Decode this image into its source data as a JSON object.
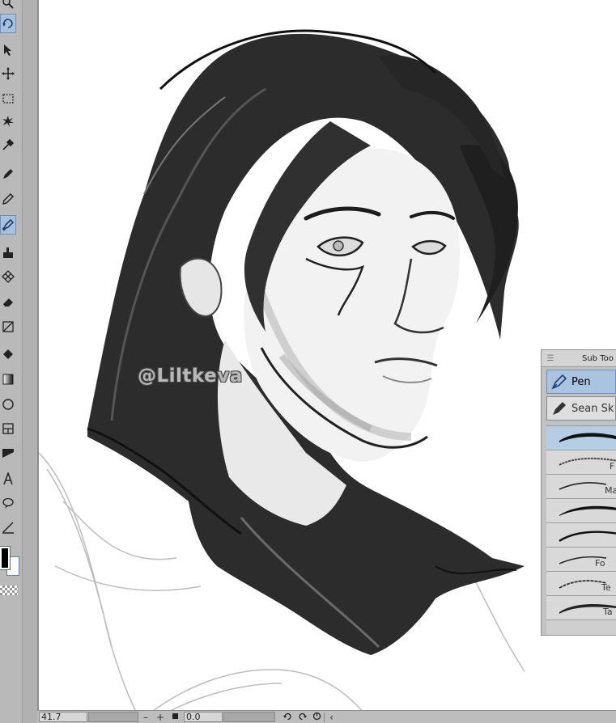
{
  "toolbar": {
    "tools": [
      {
        "name": "zoom-tool-icon",
        "active": false
      },
      {
        "name": "rotate-view-tool-icon",
        "active": true
      },
      {
        "name": "object-select-tool-icon",
        "active": false
      },
      {
        "name": "move-layer-tool-icon",
        "active": false
      },
      {
        "name": "rectangle-selection-tool-icon",
        "active": false
      },
      {
        "name": "auto-select-tool-icon",
        "active": false
      },
      {
        "name": "eyedropper-tool-icon",
        "active": false
      },
      {
        "name": "pen-tool-icon",
        "active": false
      },
      {
        "name": "pencil-tool-icon",
        "active": false
      },
      {
        "name": "brush-tool-icon",
        "active": true
      },
      {
        "name": "airbrush-tool-icon",
        "active": false
      },
      {
        "name": "decoration-tool-icon",
        "active": false
      },
      {
        "name": "eraser-tool-icon",
        "active": false
      },
      {
        "name": "blend-tool-icon",
        "active": false
      },
      {
        "name": "fill-tool-icon",
        "active": false
      },
      {
        "name": "gradient-tool-icon",
        "active": false
      },
      {
        "name": "figure-tool-icon",
        "active": false
      },
      {
        "name": "frame-border-tool-icon",
        "active": false
      },
      {
        "name": "ruler-tool-icon",
        "active": false
      },
      {
        "name": "text-tool-icon",
        "active": false
      },
      {
        "name": "balloon-tool-icon",
        "active": false
      },
      {
        "name": "correct-line-tool-icon",
        "active": false
      }
    ],
    "main_color": "#000000",
    "sub_color": "#ffffff"
  },
  "canvas": {
    "watermark": "@Liltkeva"
  },
  "statusbar": {
    "zoom_value": "41.7",
    "rotation_value": "0.0",
    "zoom_out_label": "–",
    "zoom_in_label": "+"
  },
  "subtool_panel": {
    "title": "Sub Too",
    "groups": [
      {
        "label": "Pen",
        "icon": "pen-nib-icon",
        "active": true
      },
      {
        "label": "Sean Sk",
        "icon": "custom-pen-icon",
        "active": false
      }
    ],
    "brushes": [
      {
        "label": "",
        "active": true
      },
      {
        "label": "F",
        "active": false
      },
      {
        "label": "Ma",
        "active": false
      },
      {
        "label": "",
        "active": false
      },
      {
        "label": "",
        "active": false
      },
      {
        "label": "Fo",
        "active": false
      },
      {
        "label": "Te",
        "active": false
      },
      {
        "label": "Ta",
        "active": false
      }
    ]
  },
  "colors": {
    "panel_bg": "#c2c2c2",
    "active_highlight": "#aac4e0",
    "toolbar_bg": "#b9b9b9"
  }
}
